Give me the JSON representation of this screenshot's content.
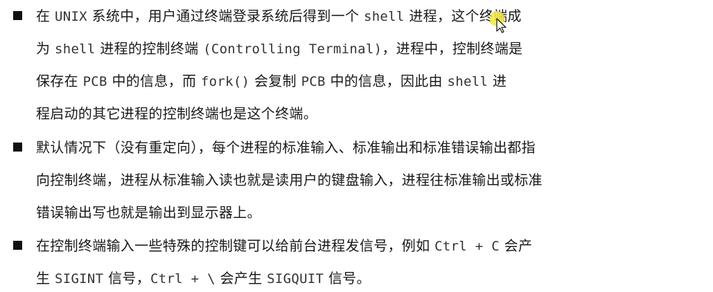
{
  "bullets": [
    {
      "lines": [
        [
          {
            "t": "在 ",
            "m": false
          },
          {
            "t": "UNIX",
            "m": true
          },
          {
            "t": " 系统中，用户通过终端登录系统后得到一个 ",
            "m": false
          },
          {
            "t": "shell",
            "m": true
          },
          {
            "t": " 进程，这个终端成",
            "m": false
          }
        ],
        [
          {
            "t": "为 ",
            "m": false
          },
          {
            "t": "shell",
            "m": true
          },
          {
            "t": " 进程的控制终端 ",
            "m": false
          },
          {
            "t": "(Controlling Terminal)",
            "m": true
          },
          {
            "t": "，进程中，控制终端是",
            "m": false
          }
        ],
        [
          {
            "t": "保存在 ",
            "m": false
          },
          {
            "t": "PCB",
            "m": true
          },
          {
            "t": " 中的信息，而 ",
            "m": false
          },
          {
            "t": "fork()",
            "m": true
          },
          {
            "t": " 会复制 ",
            "m": false
          },
          {
            "t": "PCB",
            "m": true
          },
          {
            "t": " 中的信息，因此由 ",
            "m": false
          },
          {
            "t": "shell",
            "m": true
          },
          {
            "t": " 进",
            "m": false
          }
        ],
        [
          {
            "t": "程启动的其它进程的控制终端也是这个终端。",
            "m": false
          }
        ]
      ]
    },
    {
      "lines": [
        [
          {
            "t": "默认情况下（没有重定向），每个进程的标准输入、标准输出和标准错误输出都指",
            "m": false
          }
        ],
        [
          {
            "t": "向控制终端，进程从标准输入读也就是读用户的键盘输入，进程往标准输出或标准",
            "m": false
          }
        ],
        [
          {
            "t": "错误输出写也就是输出到显示器上。",
            "m": false
          }
        ]
      ]
    },
    {
      "lines": [
        [
          {
            "t": "在控制终端输入一些特殊的控制键可以给前台进程发信号，例如 ",
            "m": false
          },
          {
            "t": "Ctrl + C",
            "m": true
          },
          {
            "t": " 会产",
            "m": false
          }
        ],
        [
          {
            "t": "生 ",
            "m": false
          },
          {
            "t": "SIGINT",
            "m": true
          },
          {
            "t": " 信号，",
            "m": false
          },
          {
            "t": "Ctrl + \\",
            "m": true
          },
          {
            "t": " 会产生 ",
            "m": false
          },
          {
            "t": "SIGQUIT",
            "m": true
          },
          {
            "t": " 信号。",
            "m": false
          }
        ]
      ]
    }
  ],
  "highlight_color": "#f3ea3c",
  "cursor_icon": "mouse-pointer-icon"
}
